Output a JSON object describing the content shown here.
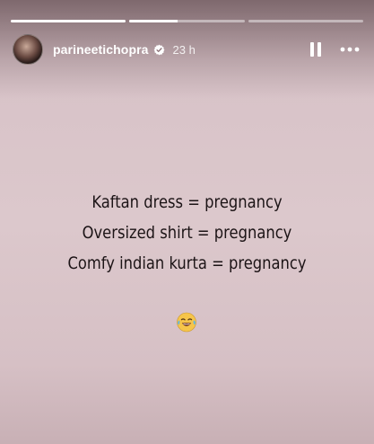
{
  "story": {
    "progress": [
      1.0,
      0.42,
      0.0
    ],
    "user": {
      "username": "parineetichopra",
      "time_ago": "23 h"
    },
    "icons": {
      "avatar": "profile-avatar",
      "verified": "verified-badge-icon",
      "pause": "pause-icon",
      "more": "more-horizontal-icon",
      "emoji": "face-with-tears-of-joy-emoji"
    },
    "text_lines": [
      "Kaftan dress = pregnancy",
      "Oversized shirt = pregnancy",
      "Comfy indian kurta = pregnancy"
    ]
  },
  "colors": {
    "background": "#dcc8cc",
    "text": "#1c1416",
    "overlay_text": "#ffffff"
  }
}
